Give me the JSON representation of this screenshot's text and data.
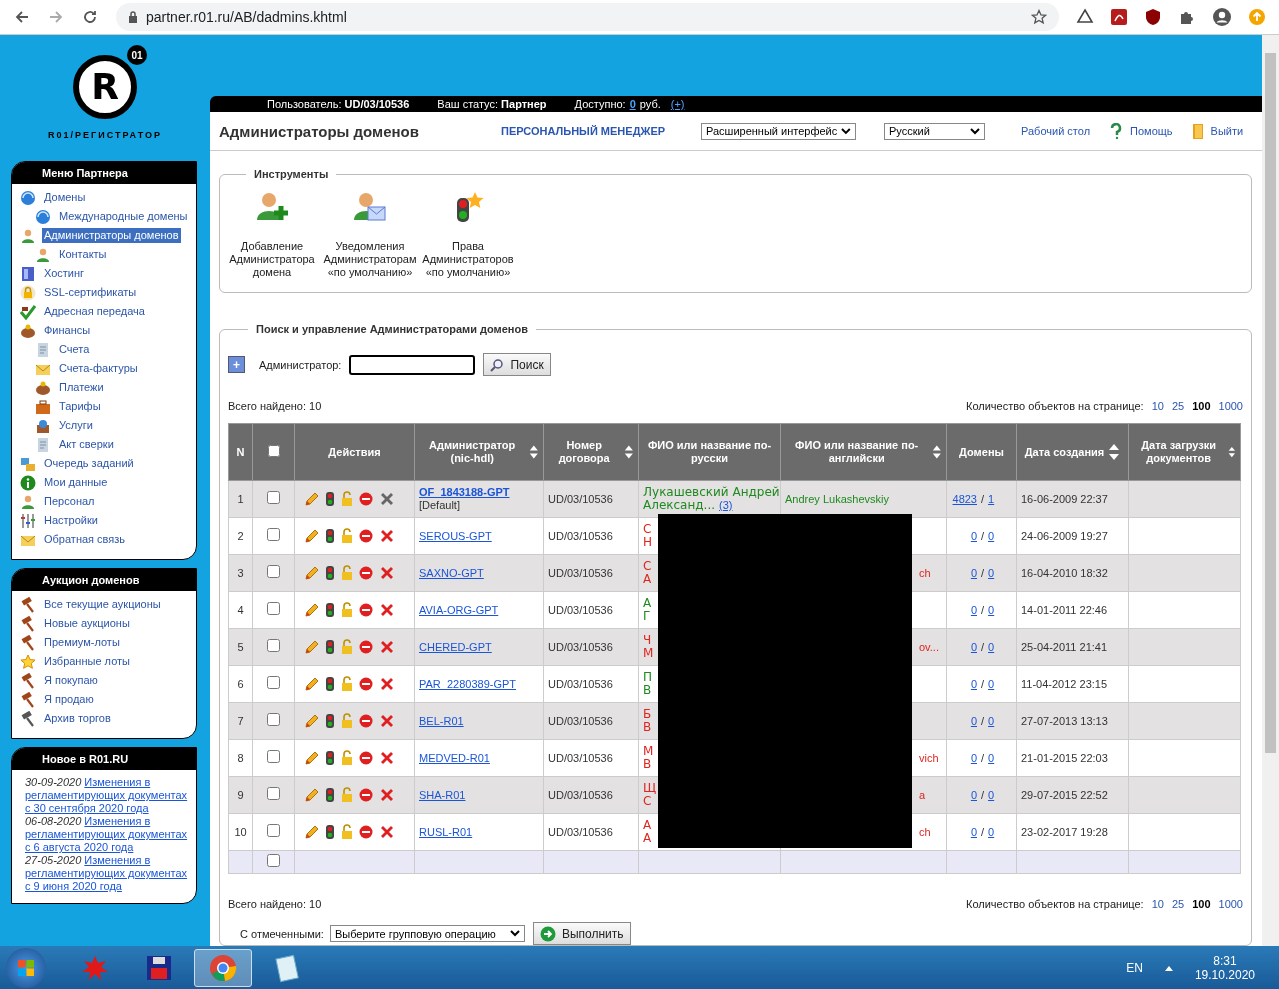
{
  "browser": {
    "url": "partner.r01.ru/AB/dadmins.khtml"
  },
  "logo": {
    "badge": "01",
    "letter": "R",
    "caption": "R01/РЕГИСТРАТОР"
  },
  "sidebar": {
    "menus": [
      {
        "title": "Меню Партнера",
        "items": [
          {
            "label": "Домены",
            "selected": false,
            "children": [
              {
                "label": "Международные домены",
                "selected": false
              }
            ]
          },
          {
            "label": "Администраторы доменов",
            "selected": true,
            "children": [
              {
                "label": "Контакты",
                "selected": false
              }
            ]
          },
          {
            "label": "Хостинг",
            "selected": false
          },
          {
            "label": "SSL-сертификаты",
            "selected": false
          },
          {
            "label": "Адресная передача",
            "selected": false
          },
          {
            "label": "Финансы",
            "selected": false,
            "children": [
              {
                "label": "Счета",
                "selected": false
              },
              {
                "label": "Счета-фактуры",
                "selected": false
              },
              {
                "label": "Платежи",
                "selected": false
              },
              {
                "label": "Тарифы",
                "selected": false
              },
              {
                "label": "Услуги",
                "selected": false
              },
              {
                "label": "Акт сверки",
                "selected": false
              }
            ]
          },
          {
            "label": "Очередь заданий",
            "selected": false
          },
          {
            "label": "Мои данные",
            "selected": false
          },
          {
            "label": "Персонал",
            "selected": false
          },
          {
            "label": "Настройки",
            "selected": false
          },
          {
            "label": "Обратная связь",
            "selected": false
          }
        ]
      },
      {
        "title": "Аукцион доменов",
        "items": [
          {
            "label": "Все текущие аукционы",
            "selected": false
          },
          {
            "label": "Новые аукционы",
            "selected": false
          },
          {
            "label": "Премиум-лоты",
            "selected": false
          },
          {
            "label": "Избранные лоты",
            "selected": false
          },
          {
            "label": "Я покупаю",
            "selected": false
          },
          {
            "label": "Я продаю",
            "selected": false
          },
          {
            "label": "Архив торгов",
            "selected": false
          }
        ]
      }
    ]
  },
  "news": {
    "title": "Новое в R01.RU",
    "items": [
      {
        "date": "30-09-2020",
        "link": "Изменения в регламентирующих документах с 30 сентября 2020 года"
      },
      {
        "date": "06-08-2020",
        "link": "Изменения в регламентирующих документах с 6 августа 2020 года"
      },
      {
        "date": "27-05-2020",
        "link": "Изменения в регламентирующих документах с 9 июня 2020 года"
      }
    ]
  },
  "account_bar": {
    "user_label": "Пользователь:",
    "user": "UD/03/10536",
    "status_label": "Ваш статус:",
    "status": "Партнер",
    "balance_label": "Доступно:",
    "balance": "0",
    "currency": "руб.",
    "topup": "(+)"
  },
  "title_bar": {
    "title": "Администраторы доменов",
    "manager_link": "ПЕРСОНАЛЬНЫЙ МЕНЕДЖЕР",
    "interface_select": "Расширенный интерфейс",
    "language_select": "Русский",
    "links": [
      {
        "label": "Рабочий стол",
        "kind": "plain"
      },
      {
        "label": "Помощь",
        "kind": "help"
      },
      {
        "label": "Выйти",
        "kind": "exit"
      }
    ]
  },
  "tools": {
    "legend": "Инструменты",
    "items": [
      {
        "lines": [
          "Добавление",
          "Администратора",
          "домена"
        ],
        "kind": "add"
      },
      {
        "lines": [
          "Уведомления",
          "Администраторам",
          "«по умолчанию»"
        ],
        "kind": "notify"
      },
      {
        "lines": [
          "Права",
          "Администраторов",
          "«по умолчанию»"
        ],
        "kind": "rights"
      }
    ]
  },
  "search": {
    "legend": "Поиск и управление Администраторами доменов",
    "expand": "+",
    "label": "Администратор:",
    "button": "Поиск"
  },
  "summary_top": {
    "total": "Всего найдено: 10",
    "per_page_label": "Количество объектов на странице:",
    "per_page": [
      {
        "label": "10",
        "selected": false
      },
      {
        "label": "25",
        "selected": false
      },
      {
        "label": "100",
        "selected": true
      },
      {
        "label": "1000",
        "selected": false
      }
    ]
  },
  "table": {
    "redaction": true,
    "columns": [
      {
        "kind": "text",
        "label": "N",
        "sortable": false
      },
      {
        "kind": "checkbox",
        "checked": false
      },
      {
        "kind": "text",
        "label": "Действия",
        "sortable": false
      },
      {
        "kind": "text",
        "label": "Администратор (nic-hdl)",
        "sortable": true
      },
      {
        "kind": "text",
        "label": "Номер договора",
        "sortable": true
      },
      {
        "kind": "text",
        "label": "ФИО или название по-русски",
        "sortable": false
      },
      {
        "kind": "text",
        "label": "ФИО или название по-английски",
        "sortable": true
      },
      {
        "kind": "text",
        "label": "Домены",
        "sortable": false
      },
      {
        "kind": "text",
        "label": "Дата создания",
        "sortable": true
      },
      {
        "kind": "text",
        "label": "Дата загрузки документов",
        "sortable": true
      }
    ],
    "rows": [
      {
        "n": "1",
        "checked": false,
        "admin": "OF_1843188-GPT",
        "admin_note": "[Default]",
        "contract": "UD/03/10536",
        "ru": [
          "Лукашевский Андрей",
          "Александ..."
        ],
        "ru_link": "(3)",
        "en": "Andrey Lukashevskiy",
        "color": "#1e8a1e",
        "masked": false,
        "domains": [
          "4823",
          "1"
        ],
        "domains_sep": "/",
        "created": "16-06-2009 22:37",
        "delete_disabled": true
      },
      {
        "n": "2",
        "checked": false,
        "admin": "SEROUS-GPT",
        "contract": "UD/03/10536",
        "ru": [
          "С",
          "Н"
        ],
        "color": "#e0251f",
        "domains": [
          "0",
          "0"
        ],
        "domains_sep": "/",
        "created": "24-06-2009 19:27",
        "delete_disabled": false
      },
      {
        "n": "3",
        "checked": false,
        "admin": "SAXNO-GPT",
        "contract": "UD/03/10536",
        "ru": [
          "С",
          "А"
        ],
        "en": "ch",
        "color": "#e0251f",
        "masked": true,
        "domains": [
          "0",
          "0"
        ],
        "domains_sep": "/",
        "created": "16-04-2010 18:32",
        "delete_disabled": false
      },
      {
        "n": "4",
        "checked": false,
        "admin": "AVIA-ORG-GPT",
        "contract": "UD/03/10536",
        "ru": [
          "А",
          "Г"
        ],
        "color": "#1e8a1e",
        "domains": [
          "0",
          "0"
        ],
        "domains_sep": "/",
        "created": "14-01-2011 22:46",
        "delete_disabled": false
      },
      {
        "n": "5",
        "checked": false,
        "admin": "CHERED-GPT",
        "contract": "UD/03/10536",
        "ru": [
          "Ч",
          "М"
        ],
        "en": "ov...",
        "color": "#e0251f",
        "masked": true,
        "domains": [
          "0",
          "0"
        ],
        "domains_sep": "/",
        "created": "25-04-2011 21:41",
        "delete_disabled": false
      },
      {
        "n": "6",
        "checked": false,
        "admin": "PAR_2280389-GPT",
        "contract": "UD/03/10536",
        "ru": [
          "П",
          "В"
        ],
        "color": "#1e8a1e",
        "domains": [
          "0",
          "0"
        ],
        "domains_sep": "/",
        "created": "11-04-2012 23:15",
        "delete_disabled": false
      },
      {
        "n": "7",
        "checked": false,
        "admin": "BEL-R01",
        "contract": "UD/03/10536",
        "ru": [
          "Б",
          "В"
        ],
        "color": "#e0251f",
        "domains": [
          "0",
          "0"
        ],
        "domains_sep": "/",
        "created": "27-07-2013 13:13",
        "delete_disabled": false
      },
      {
        "n": "8",
        "checked": false,
        "admin": "MEDVED-R01",
        "contract": "UD/03/10536",
        "ru": [
          "М",
          "В"
        ],
        "en": "vich",
        "color": "#e0251f",
        "masked": true,
        "domains": [
          "0",
          "0"
        ],
        "domains_sep": "/",
        "created": "21-01-2015 22:03",
        "delete_disabled": false
      },
      {
        "n": "9",
        "checked": false,
        "admin": "SHA-R01",
        "contract": "UD/03/10536",
        "ru": [
          "Щ",
          "С"
        ],
        "en": "a",
        "color": "#e0251f",
        "masked": true,
        "domains": [
          "0",
          "0"
        ],
        "domains_sep": "/",
        "created": "29-07-2015 22:52",
        "delete_disabled": false
      },
      {
        "n": "10",
        "checked": false,
        "admin": "RUSL-R01",
        "contract": "UD/03/10536",
        "ru": [
          "А",
          "А"
        ],
        "en": "ch",
        "color": "#e0251f",
        "masked": true,
        "domains": [
          "0",
          "0"
        ],
        "domains_sep": "/",
        "created": "23-02-2017 19:28",
        "delete_disabled": false
      }
    ],
    "footer_row": {
      "checked": false
    }
  },
  "summary_bottom": {
    "total": "Всего найдено: 10",
    "per_page_label": "Количество объектов на странице:",
    "per_page": [
      {
        "label": "10",
        "selected": false
      },
      {
        "label": "25",
        "selected": false
      },
      {
        "label": "100",
        "selected": true
      },
      {
        "label": "1000",
        "selected": false
      }
    ]
  },
  "bulk": {
    "label": "С отмеченными:",
    "select": "Выберите групповую операцию",
    "button": "Выполнить"
  },
  "taskbar": {
    "apps": [
      {
        "kind": "paint",
        "selected": false
      },
      {
        "kind": "floppy",
        "selected": false
      },
      {
        "kind": "chrome",
        "selected": true
      },
      {
        "kind": "notepad",
        "selected": false
      }
    ],
    "language": "EN",
    "time": "8:31",
    "date": "19.10.2020"
  }
}
